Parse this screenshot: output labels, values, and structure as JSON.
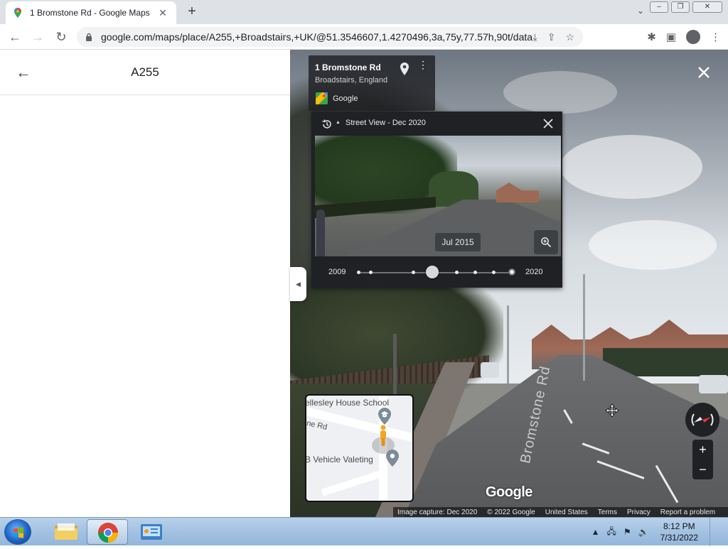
{
  "browser": {
    "tab_title": "1 Bromstone Rd - Google Maps",
    "url": "google.com/maps/place/A255,+Broadstairs,+UK/@51.3546607,1.4270496,3a,75y,77.57h,90t/data=!3m...",
    "new_tab_symbol": "+",
    "tab_close_symbol": "✕",
    "icons": [
      "back-icon",
      "forward-icon",
      "reload-icon",
      "lock-icon",
      "install-icon",
      "share-icon",
      "bookmark-star-icon",
      "extensions-icon",
      "side-panel-icon",
      "profile-icon",
      "menu-icon"
    ]
  },
  "left_panel": {
    "title": "A255",
    "back_symbol": "←",
    "collapse_symbol": "◀"
  },
  "street_view": {
    "place_title": "1 Bromstone Rd",
    "place_subtitle": "Broadstairs, England",
    "brand": "Google",
    "road_marking": "Bromstone Rd",
    "watermark": "Google",
    "time_travel": {
      "title": "Street View - Dec 2020",
      "selected_date": "Jul 2015",
      "start_year": "2009",
      "end_year": "2020",
      "snapshot_count": 9,
      "selected_index": 3
    },
    "minimap": {
      "label_top": "ellesley House School",
      "label_road": "ne Rd",
      "label_bottom": "B Vehicle Valeting"
    },
    "zoom_in": "+",
    "zoom_out": "−",
    "attribution": [
      "Image capture: Dec 2020",
      "© 2022 Google",
      "United States",
      "Terms",
      "Privacy",
      "Report a problem"
    ]
  },
  "taskbar": {
    "time": "8:12 PM",
    "date": "7/31/2022",
    "apps": [
      "file-explorer",
      "chrome",
      "control-panel"
    ]
  }
}
